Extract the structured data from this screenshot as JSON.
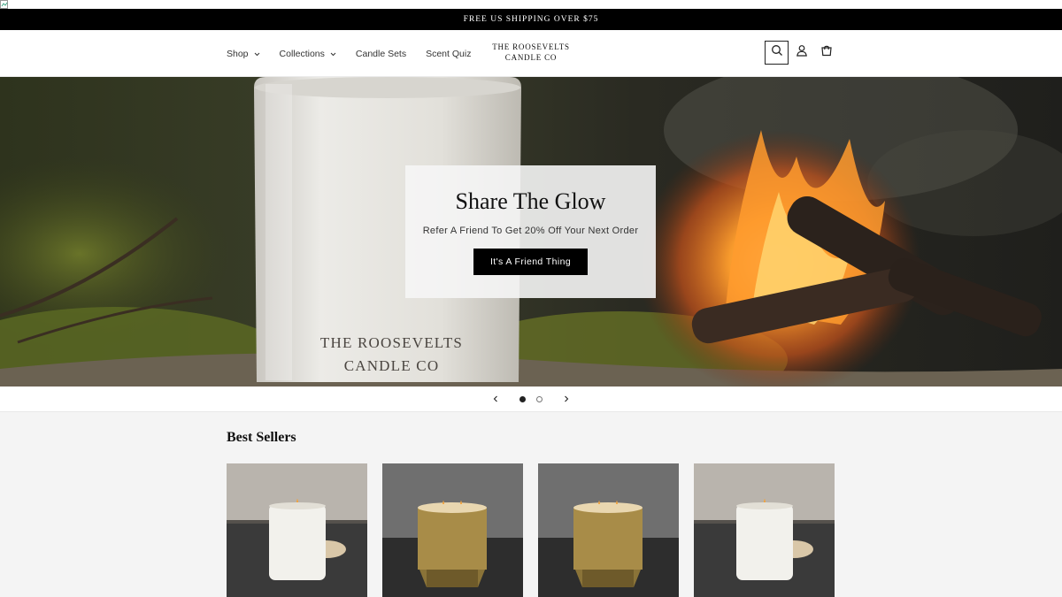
{
  "announcement": {
    "text": "FREE US SHIPPING OVER $75"
  },
  "nav": {
    "items": [
      {
        "label": "Shop",
        "has_dropdown": true
      },
      {
        "label": "Collections",
        "has_dropdown": true
      },
      {
        "label": "Candle Sets",
        "has_dropdown": false
      },
      {
        "label": "Scent Quiz",
        "has_dropdown": false
      }
    ]
  },
  "logo": {
    "line1": "THE ROOSEVELTS",
    "line2": "CANDLE CO"
  },
  "header_icons": [
    "search-icon",
    "account-icon",
    "cart-icon"
  ],
  "hero": {
    "title": "Share The Glow",
    "subtitle": "Refer A Friend To Get 20% Off Your Next Order",
    "button_label": "It's A Friend Thing",
    "jar_line1": "THE ROOSEVELTS",
    "jar_line2": "CANDLE CO"
  },
  "slider": {
    "current_slide": 1,
    "total_slides": 2
  },
  "best_sellers": {
    "title": "Best Sellers",
    "products": [
      {
        "variant": "white"
      },
      {
        "variant": "gold"
      },
      {
        "variant": "gold"
      },
      {
        "variant": "white"
      }
    ]
  },
  "colors": {
    "announcement_bg": "#000000",
    "button_bg": "#000000",
    "section_bg": "#f4f4f4"
  }
}
